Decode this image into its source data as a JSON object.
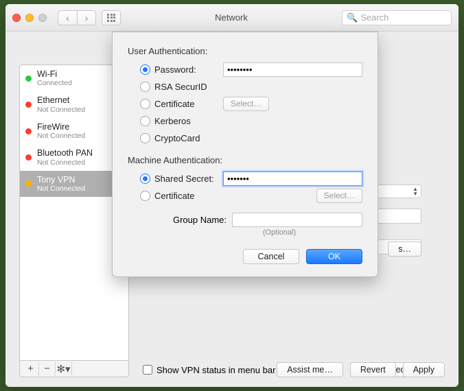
{
  "title": "Network",
  "search_placeholder": "Search",
  "services": [
    {
      "name": "Wi-Fi",
      "status": "Connected",
      "led": "green"
    },
    {
      "name": "Ethernet",
      "status": "Not Connected",
      "led": "red"
    },
    {
      "name": "FireWire",
      "status": "Not Connected",
      "led": "red"
    },
    {
      "name": "Bluetooth PAN",
      "status": "Not Connected",
      "led": "red"
    },
    {
      "name": "Tony VPN",
      "status": "Not Connected",
      "led": "orange"
    }
  ],
  "show_vpn_label": "Show VPN status in menu bar",
  "advanced_label": "Advanced…",
  "assist_label": "Assist me…",
  "revert_label": "Revert",
  "apply_label": "Apply",
  "settings_label": "s…",
  "sheet": {
    "user_auth_heading": "User Authentication:",
    "options_user": {
      "password": "Password:",
      "rsa": "RSA SecurID",
      "cert": "Certificate",
      "kerberos": "Kerberos",
      "cryptocard": "CryptoCard"
    },
    "password_value": "••••••••",
    "select_label": "Select…",
    "machine_auth_heading": "Machine Authentication:",
    "options_machine": {
      "shared_secret": "Shared Secret:",
      "cert": "Certificate"
    },
    "shared_secret_value": "•••••••",
    "group_name_label": "Group Name:",
    "group_name_value": "",
    "optional_label": "(Optional)",
    "cancel_label": "Cancel",
    "ok_label": "OK"
  }
}
